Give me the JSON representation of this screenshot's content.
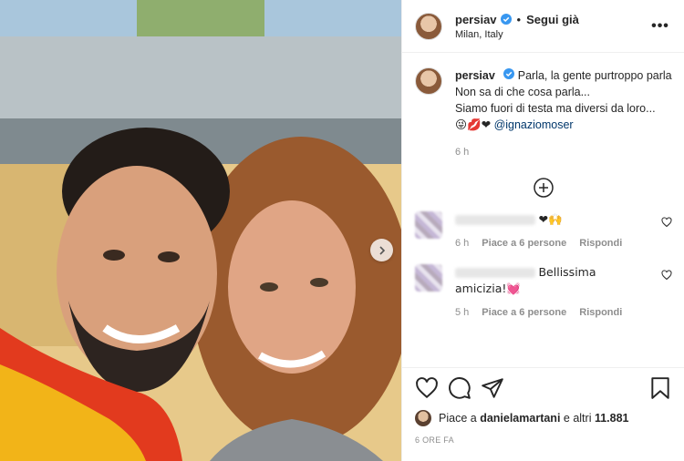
{
  "header": {
    "username": "persiav",
    "separator": "•",
    "follow_label": "Segui già",
    "location": "Milan, Italy",
    "more_label": "•••"
  },
  "caption": {
    "username": "persiav",
    "line1": "Parla, la gente purtroppo parla",
    "line2": "Non sa di che cosa parla...",
    "line3": "Siamo fuori di testa ma diversi da loro...",
    "emojis": "😜💋❤",
    "mention": "@ignaziomoser",
    "time": "6 h"
  },
  "comments": [
    {
      "text": "❤🙌",
      "time": "6 h",
      "likes": "Piace a 6 persone",
      "reply": "Rispondi"
    },
    {
      "text": "Bellissima amicizia!💓",
      "time": "5 h",
      "likes": "Piace a 6 persone",
      "reply": "Rispondi"
    }
  ],
  "footer": {
    "likes_prefix": "Piace a ",
    "likes_user": "danielamartani",
    "likes_suffix": " e altri ",
    "likes_count": "11.881",
    "timestamp": "6 ORE FA"
  },
  "colors": {
    "link": "#00376b",
    "verified": "#3897f0",
    "muted": "#8e8e8e",
    "heart": "#ed4956"
  },
  "icons": [
    "verified-badge-icon",
    "more-options-icon",
    "add-comments-icon",
    "heart-icon",
    "comment-icon",
    "share-icon",
    "bookmark-icon",
    "chevron-right-icon"
  ]
}
